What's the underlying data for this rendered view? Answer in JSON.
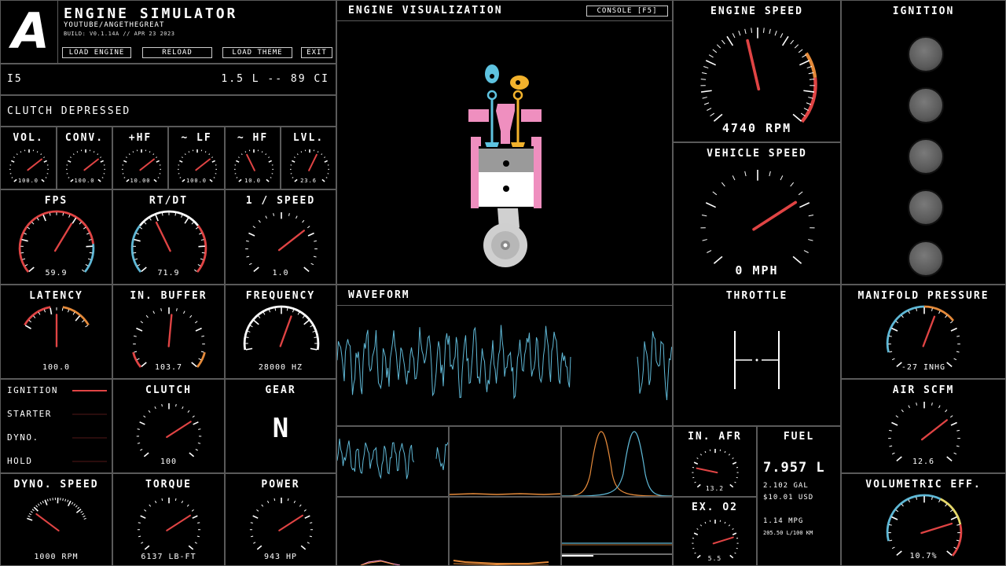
{
  "app": {
    "logo_letter": "A",
    "title": "ENGINE SIMULATOR",
    "subtitle": "YOUTUBE/ANGETHEGREAT",
    "build": "BUILD: V0.1.14A // APR 23 2023"
  },
  "header_buttons": [
    "LOAD ENGINE",
    "RELOAD",
    "LOAD THEME",
    "EXIT"
  ],
  "engine_info": {
    "name": "I5",
    "displacement": "1.5 L -- 89 CI"
  },
  "clutch_status": "CLUTCH DEPRESSED",
  "audio_gauges": [
    {
      "label": "VOL.",
      "value": "100.0",
      "level": 0.7
    },
    {
      "label": "CONV.",
      "value": "100.0",
      "level": 0.7
    },
    {
      "label": "+HF",
      "value": "10.00",
      "level": 0.7
    },
    {
      "label": "~ LF",
      "value": "100.0",
      "level": 0.7
    },
    {
      "label": "~ HF",
      "value": "10.0",
      "level": 0.4
    },
    {
      "label": "LVL.",
      "value": "23.6",
      "level": 0.6
    }
  ],
  "perf_gauges": [
    {
      "label": "FPS",
      "value": "59.9",
      "level": 0.62
    },
    {
      "label": "RT/DT",
      "value": "71.9",
      "level": 0.4
    },
    {
      "label": "1 / SPEED",
      "value": "1.0",
      "level": 0.7
    }
  ],
  "latency": {
    "label": "LATENCY",
    "value": "100.0",
    "level": 0.5
  },
  "in_buffer": {
    "label": "IN. BUFFER",
    "value": "103.7",
    "level": 0.52
  },
  "frequency": {
    "label": "FREQUENCY",
    "value": "28000 HZ",
    "level": 0.6
  },
  "indicators": {
    "items": [
      {
        "label": "IGNITION",
        "color": "#e04444"
      },
      {
        "label": "STARTER",
        "color": "#2a0c0c"
      },
      {
        "label": "DYNO.",
        "color": "#2a0c0c"
      },
      {
        "label": "HOLD",
        "color": "#2a0c0c"
      }
    ]
  },
  "clutch": {
    "label": "CLUTCH",
    "value": "100",
    "level": 0.72
  },
  "gear": {
    "label": "GEAR",
    "value": "N"
  },
  "dyno_speed": {
    "label": "DYNO. SPEED",
    "value": "1000 RPM",
    "level": 0.12
  },
  "torque": {
    "label": "TORQUE",
    "value": "6137 LB-FT",
    "level": 0.72
  },
  "power": {
    "label": "POWER",
    "value": "943 HP",
    "level": 0.72
  },
  "engine_visualization": {
    "title": "ENGINE VISUALIZATION",
    "console_label": "CONSOLE [F5]"
  },
  "waveform": {
    "title": "WAVEFORM"
  },
  "engine_speed": {
    "label": "ENGINE SPEED",
    "value": "4740 RPM",
    "level": 0.45
  },
  "vehicle_speed": {
    "label": "VEHICLE SPEED",
    "value": "0 MPH",
    "level": 0.72
  },
  "ignition_panel": {
    "label": "IGNITION",
    "lamps": 5
  },
  "throttle": {
    "label": "THROTTLE"
  },
  "manifold_pressure": {
    "label": "MANIFOLD PRESSURE",
    "value": "-27 INHG",
    "level": 0.58
  },
  "air_scfm": {
    "label": "AIR SCFM",
    "value": "12.6",
    "level": 0.7
  },
  "in_afr": {
    "label": "IN. AFR",
    "value": "13.2",
    "level": 0.2
  },
  "ex_o2": {
    "label": "EX. O2",
    "value": "5.5",
    "level": 0.78
  },
  "fuel": {
    "label": "FUEL",
    "liters": "7.957 L",
    "gallons": "2.102 GAL",
    "cost": "$10.01 USD",
    "mpg": "1.14 MPG",
    "l100km": "205.50 L/100 KM"
  },
  "volumetric_eff": {
    "label": "VOLUMETRIC EFF.",
    "value": "10.7%",
    "level": 0.78
  },
  "colors": {
    "red": "#e04444",
    "blue": "#5fb8d6",
    "orange": "#e58a3a",
    "pink": "#ef8fbf",
    "yellow": "#f2b22c",
    "cyan": "#5ec3e0"
  }
}
